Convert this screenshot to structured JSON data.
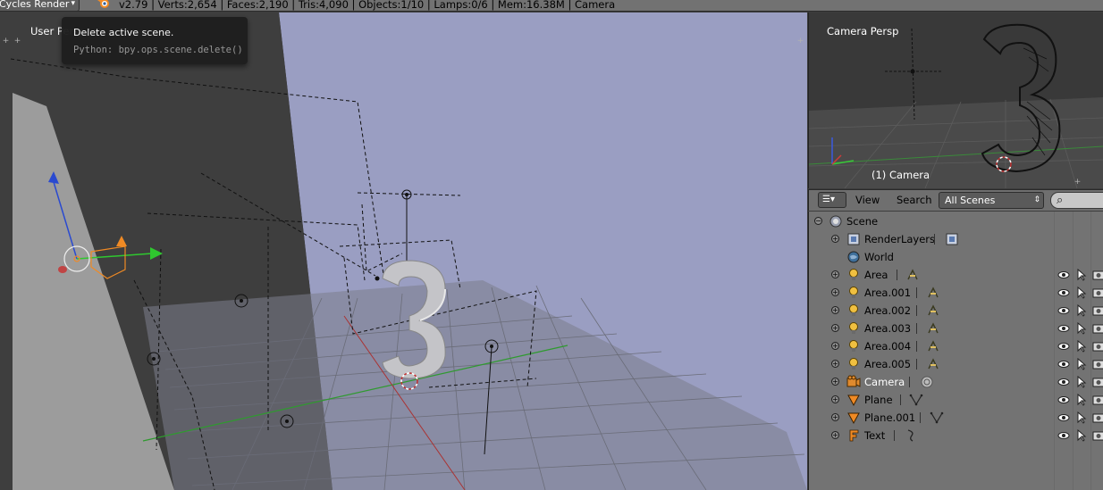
{
  "topbar": {
    "render_engine": "Cycles Render",
    "stats": "v2.79 | Verts:2,654 | Faces:2,190 | Tris:4,090 | Objects:1/10 | Lamps:0/6 | Mem:16.38M | Camera"
  },
  "viewport": {
    "label": "User Persp"
  },
  "tooltip": {
    "title": "Delete active scene.",
    "python": "Python: bpy.ops.scene.delete()"
  },
  "camera_view": {
    "label": "Camera Persp",
    "object_label": "(1) Camera"
  },
  "outliner_header": {
    "view_menu": "View",
    "search_menu": "Search",
    "display_mode": "All Scenes"
  },
  "outliner": {
    "items": [
      {
        "name": "Scene",
        "type": "scene"
      },
      {
        "name": "RenderLayers",
        "type": "renderlayers"
      },
      {
        "name": "World",
        "type": "world"
      },
      {
        "name": "Area",
        "type": "lamp"
      },
      {
        "name": "Area.001",
        "type": "lamp"
      },
      {
        "name": "Area.002",
        "type": "lamp"
      },
      {
        "name": "Area.003",
        "type": "lamp"
      },
      {
        "name": "Area.004",
        "type": "lamp"
      },
      {
        "name": "Area.005",
        "type": "lamp"
      },
      {
        "name": "Camera",
        "type": "camera"
      },
      {
        "name": "Plane",
        "type": "mesh"
      },
      {
        "name": "Plane.001",
        "type": "mesh"
      },
      {
        "name": "Text",
        "type": "text"
      }
    ]
  },
  "colors": {
    "lamp_icon": "#f0c040",
    "camera_icon": "#e08a2e",
    "selected_text": "#ffffff",
    "viewport_sky": "#9a9ec2"
  }
}
